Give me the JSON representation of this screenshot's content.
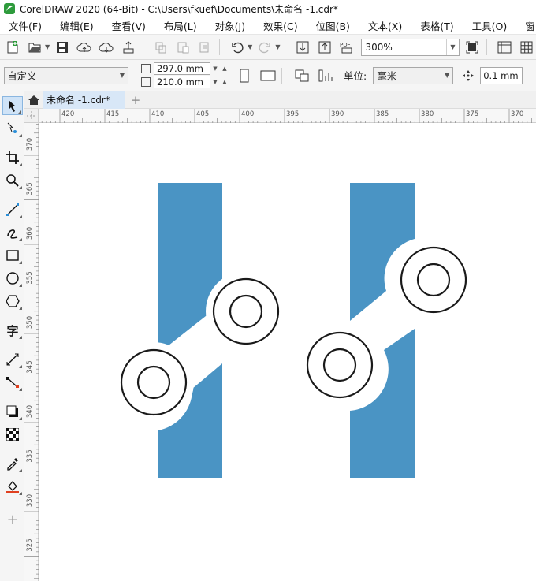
{
  "titlebar": {
    "title": "CorelDRAW 2020 (64-Bit) - C:\\Users\\fkuef\\Documents\\未命名 -1.cdr*"
  },
  "menubar": {
    "items": [
      "文件(F)",
      "编辑(E)",
      "查看(V)",
      "布局(L)",
      "对象(J)",
      "效果(C)",
      "位图(B)",
      "文本(X)",
      "表格(T)",
      "工具(O)",
      "窗口"
    ]
  },
  "toolbar": {
    "zoom": "300%",
    "pdf_label": "PDF"
  },
  "propbar": {
    "preset": "自定义",
    "width": "297.0 mm",
    "height": "210.0 mm",
    "unit_label": "单位:",
    "unit": "毫米",
    "nudge": "0.1 mm"
  },
  "toolbox": {
    "tools": [
      "pick-tool",
      "shape-tool",
      "crop-tool",
      "zoom-tool",
      "freehand-tool",
      "artistic-media-tool",
      "rectangle-tool",
      "ellipse-tool",
      "polygon-tool",
      "text-tool",
      "dimension-tool",
      "connector-tool",
      "drop-shadow-tool",
      "transparency-tool",
      "eyedropper-tool",
      "interactive-fill-tool",
      "add-tool"
    ],
    "text_tool_glyph": "字"
  },
  "tabs": {
    "document": "未命名 -1.cdr*",
    "add_symbol": "+"
  },
  "rulers": {
    "horizontal": [
      "420",
      "415",
      "410",
      "405",
      "400",
      "395",
      "390",
      "385",
      "380",
      "375",
      "370"
    ],
    "vertical": [
      "370",
      "365",
      "360",
      "355",
      "350",
      "345",
      "340",
      "335",
      "330",
      "325"
    ]
  },
  "artwork": {
    "fill_color": "#4a94c4",
    "stroke_color": "#1a1a1a",
    "background_color": "#ffffff"
  }
}
